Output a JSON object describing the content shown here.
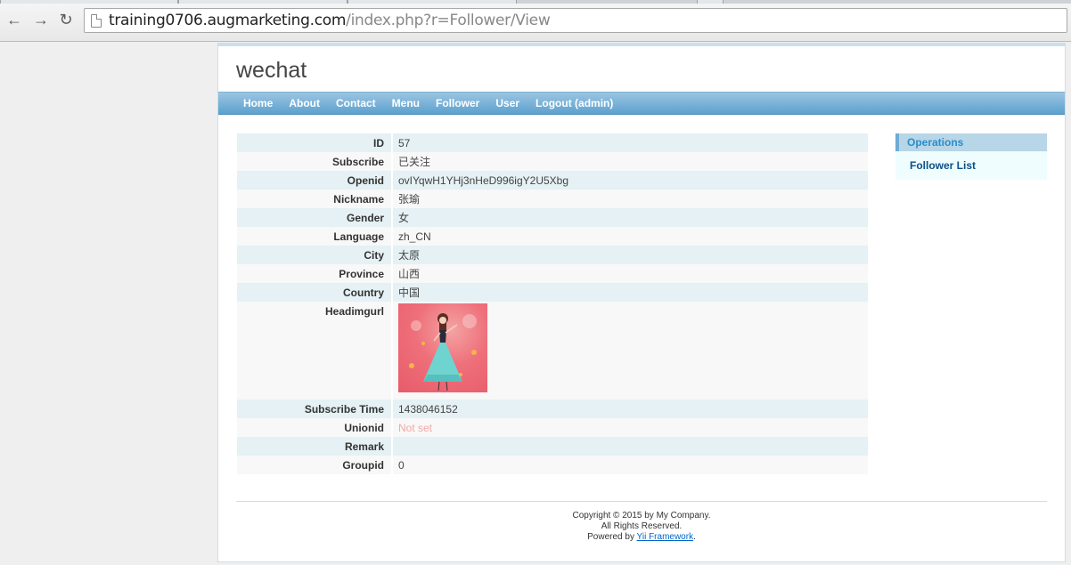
{
  "browser": {
    "url_host": "training0706.augmarketing.com",
    "url_path": "/index.php?r=Follower/View"
  },
  "site": {
    "logo": "wechat"
  },
  "menu": [
    {
      "label": "Home"
    },
    {
      "label": "About"
    },
    {
      "label": "Contact"
    },
    {
      "label": "Menu"
    },
    {
      "label": "Follower"
    },
    {
      "label": "User"
    },
    {
      "label": "Logout (admin)"
    }
  ],
  "detail": {
    "rows": [
      {
        "label": "ID",
        "value": "57"
      },
      {
        "label": "Subscribe",
        "value": "已关注"
      },
      {
        "label": "Openid",
        "value": "ovIYqwH1YHj3nHeD996igY2U5Xbg"
      },
      {
        "label": "Nickname",
        "value": "张瑜"
      },
      {
        "label": "Gender",
        "value": "女"
      },
      {
        "label": "Language",
        "value": "zh_CN"
      },
      {
        "label": "City",
        "value": "太原"
      },
      {
        "label": "Province",
        "value": "山西"
      },
      {
        "label": "Country",
        "value": "中国"
      },
      {
        "label": "Headimgurl",
        "value": ""
      },
      {
        "label": "Subscribe Time",
        "value": "1438046152"
      },
      {
        "label": "Unionid",
        "value": "Not set"
      },
      {
        "label": "Remark",
        "value": ""
      },
      {
        "label": "Groupid",
        "value": "0"
      }
    ]
  },
  "sidebar": {
    "title": "Operations",
    "items": [
      {
        "label": "Follower List"
      }
    ]
  },
  "footer": {
    "line1": "Copyright © 2015 by My Company.",
    "line2": "All Rights Reserved.",
    "powered_prefix": "Powered by ",
    "powered_link": "Yii Framework",
    "powered_suffix": "."
  }
}
